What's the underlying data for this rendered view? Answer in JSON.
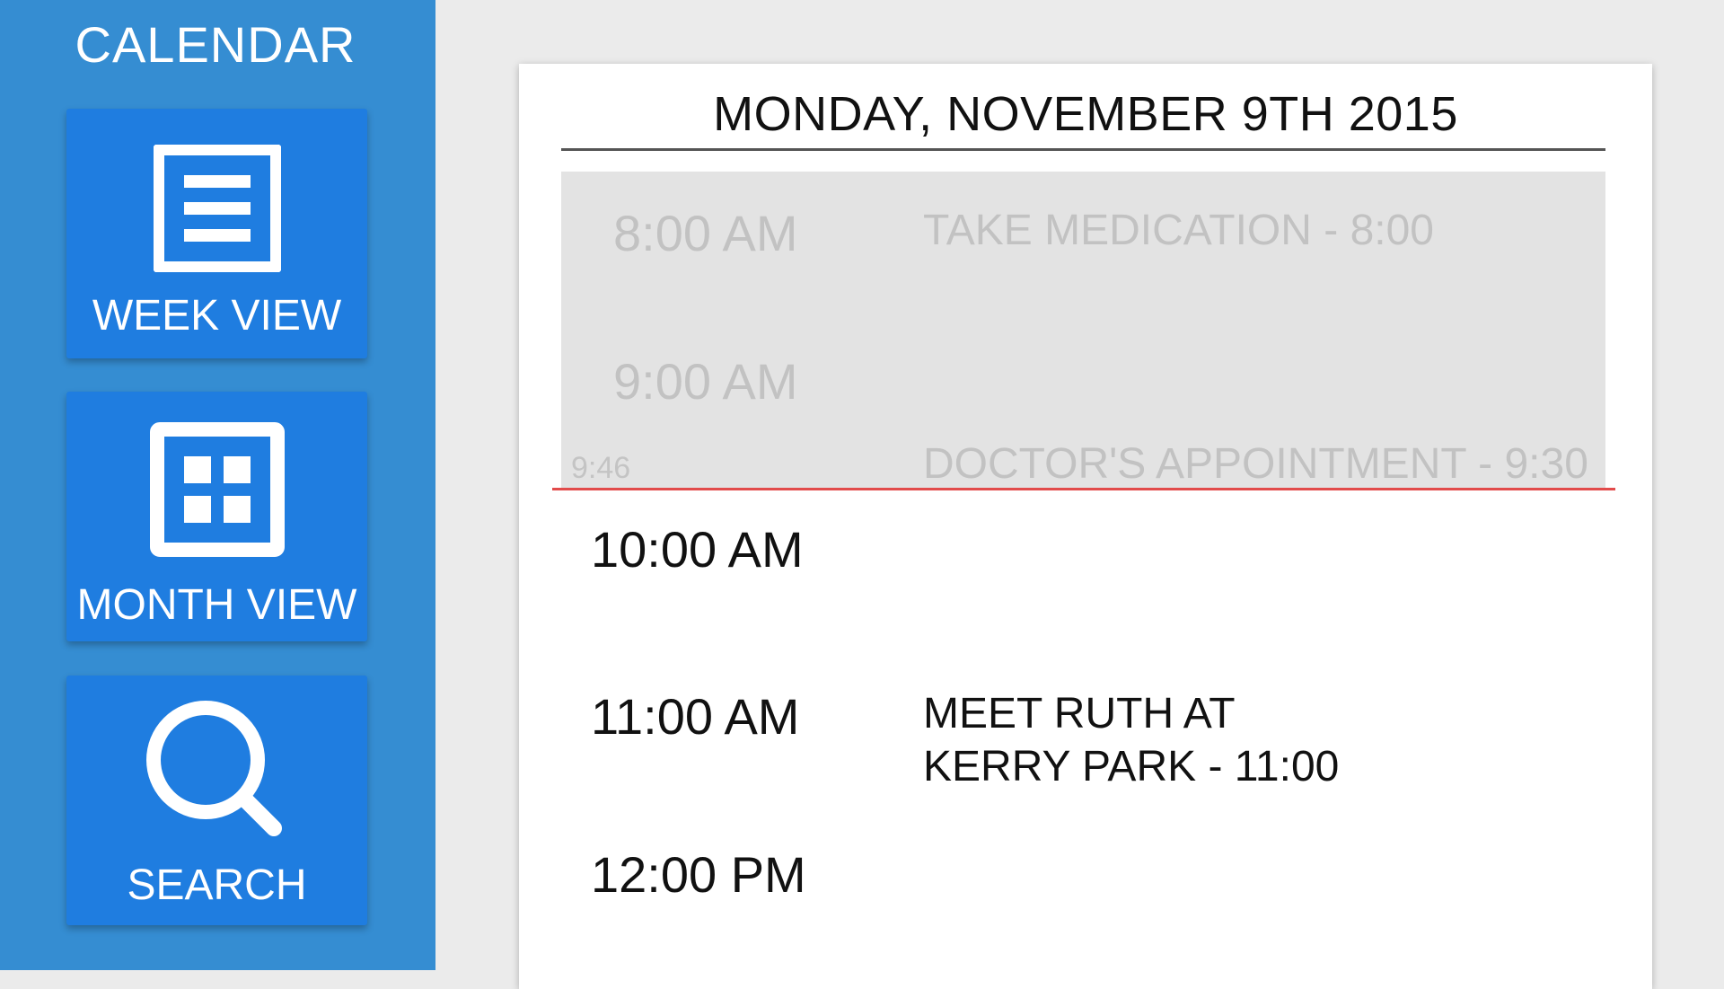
{
  "sidebar": {
    "title": "CALENDAR",
    "buttons": [
      {
        "label": "WEEK VIEW",
        "icon": "list-icon"
      },
      {
        "label": "MONTH VIEW",
        "icon": "grid-icon"
      },
      {
        "label": "SEARCH",
        "icon": "search-icon"
      }
    ]
  },
  "day": {
    "title": "MONDAY, NOVEMBER 9TH 2015",
    "current_time": "9:46",
    "slots": [
      {
        "time": "8:00 AM",
        "event": "TAKE MEDICATION - 8:00"
      },
      {
        "time": "9:00 AM",
        "event": "DOCTOR'S APPOINTMENT - 9:30"
      },
      {
        "time": "10:00 AM",
        "event": ""
      },
      {
        "time": "11:00 AM",
        "event_line1": "MEET RUTH AT",
        "event_line2": "KERRY PARK - 11:00"
      },
      {
        "time": "12:00 PM",
        "event": ""
      }
    ]
  },
  "colors": {
    "sidebar_bg": "#358dd2",
    "button_bg": "#1f7de0",
    "now_line": "#e24b4b",
    "past_block": "#e3e3e3"
  }
}
